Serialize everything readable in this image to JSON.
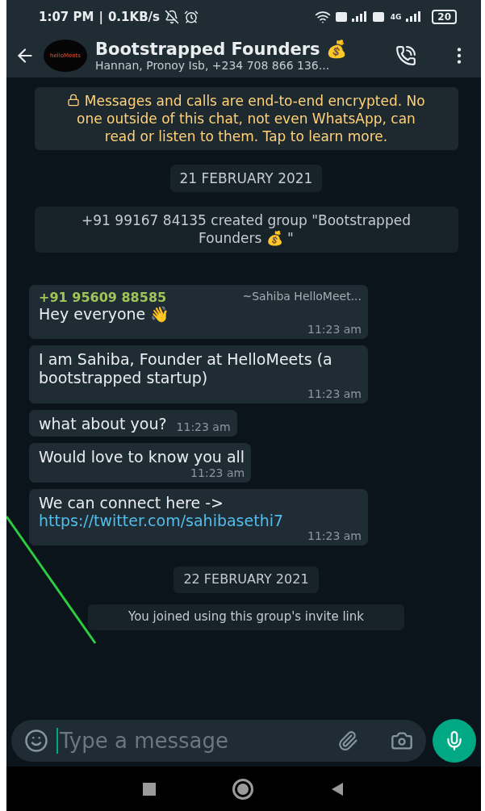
{
  "status_bar": {
    "time": "1:07 PM",
    "separator": "|",
    "speed": "0.1KB/s",
    "network_label": "4G",
    "battery": "20"
  },
  "header": {
    "avatar_text": "helloMeets",
    "title": "Bootstrapped Founders",
    "title_emoji": "💰",
    "subtitle": "Hannan, Pronoy Isb, +234 708 866 136..."
  },
  "notices": [
    {
      "kind": "encryption",
      "text": "Messages and calls are end-to-end encrypted. No one outside of this chat, not even WhatsApp, can read or listen to them. Tap to learn more."
    },
    {
      "kind": "date",
      "text": "21 FEBRUARY 2021"
    },
    {
      "kind": "system",
      "text": "+91 99167 84135 created group \"Bootstrapped Founders 💰 \""
    }
  ],
  "messages": [
    {
      "sender": "+91 95609 88585",
      "sender_name": "~Sahiba HelloMeet...",
      "text": "Hey everyone 👋",
      "time": "11:23 am",
      "wide": true
    },
    {
      "text": "I am Sahiba, Founder at HelloMeets (a bootstrapped startup)",
      "time": "11:23 am",
      "wide": true
    },
    {
      "text": "what about you?",
      "time": "11:23 am",
      "inline_time": true
    },
    {
      "text": "Would love to know you all",
      "time": "11:23 am"
    },
    {
      "text": "We can connect here ->",
      "link": "https://twitter.com/sahibasethi7",
      "time": "11:23 am",
      "wide": true
    }
  ],
  "later_notices": [
    {
      "kind": "date",
      "text": "22 FEBRUARY 2021"
    },
    {
      "kind": "system",
      "text": "You joined using this group's invite link"
    }
  ],
  "composer": {
    "placeholder": "Type a message"
  }
}
